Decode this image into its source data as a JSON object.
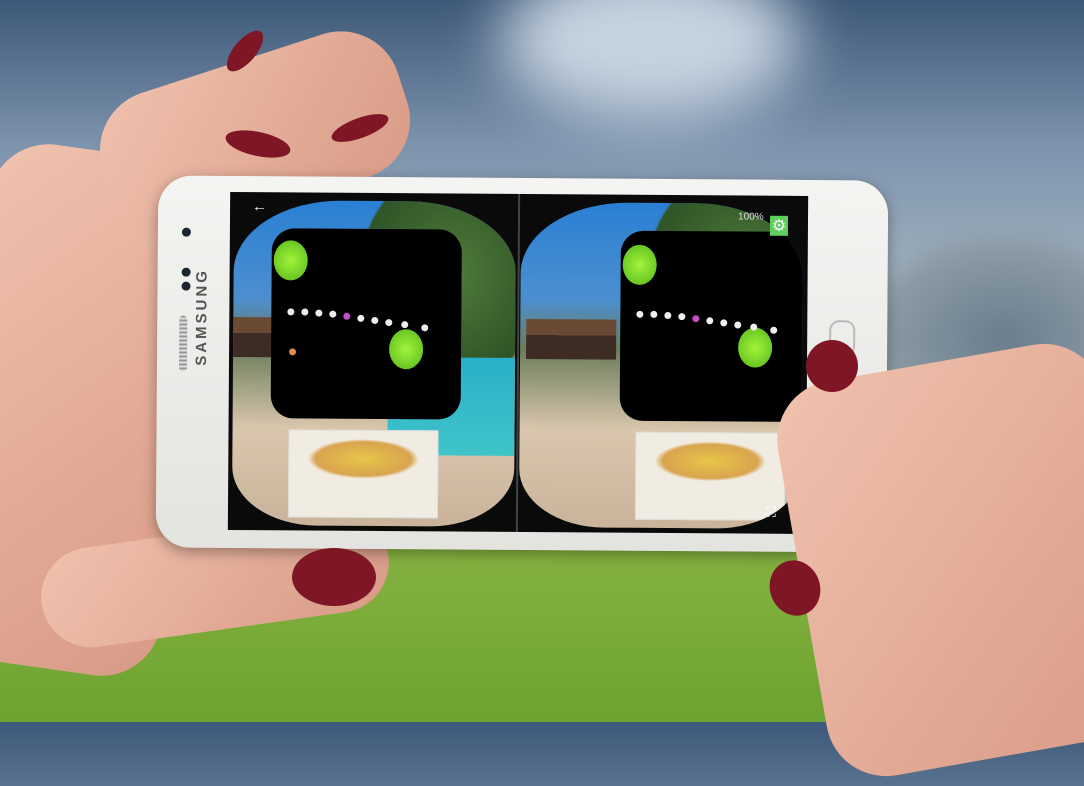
{
  "phone": {
    "brand": "SAMSUNG"
  },
  "screen": {
    "status_bar": {
      "battery": "100%"
    },
    "back_icon": "←",
    "settings_icon": "⚙",
    "fullscreen_icon": "⛶"
  }
}
